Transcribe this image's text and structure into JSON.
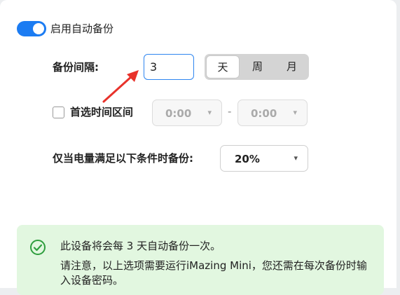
{
  "auto_backup": {
    "label": "启用自动备份",
    "enabled": true,
    "accent_color": "#1c7cf2"
  },
  "interval": {
    "label": "备份间隔:",
    "value": "3",
    "units": [
      "天",
      "周",
      "月"
    ],
    "selected_unit": "天"
  },
  "time_range": {
    "checkbox_label": "首选时间区间",
    "checked": false,
    "start": "0:00",
    "separator": "-",
    "end": "0:00"
  },
  "battery": {
    "label": "仅当电量满足以下条件时备份:",
    "value": "20%"
  },
  "info": {
    "line1": "此设备将会每 3 天自动备份一次。",
    "line2": "请注意，以上选项需要运行iMazing Mini，您还需在每次备份时输入设备密码。"
  },
  "annotation": {
    "arrow_color": "#e8322b"
  }
}
